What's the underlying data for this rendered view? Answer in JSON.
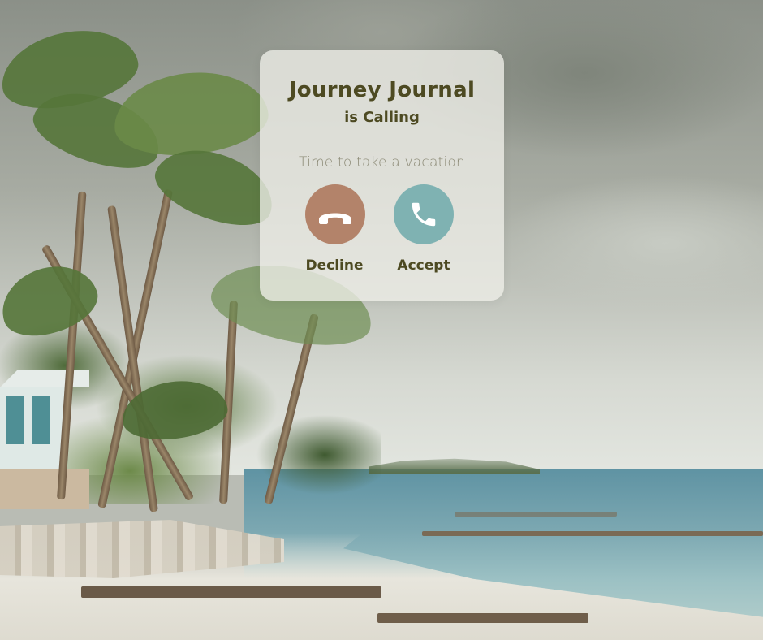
{
  "call": {
    "caller_name": "Journey Journal",
    "status": "is Calling",
    "message": "Time to take a vacation",
    "decline_label": "Decline",
    "accept_label": "Accept"
  },
  "icons": {
    "decline": "phone-hangup-icon",
    "accept": "phone-icon"
  },
  "colors": {
    "text_primary": "#4d4a22",
    "text_secondary": "#8b8975",
    "decline": "#b3836a",
    "accept": "#7fb2b2",
    "card_background": "#eeeee8"
  }
}
